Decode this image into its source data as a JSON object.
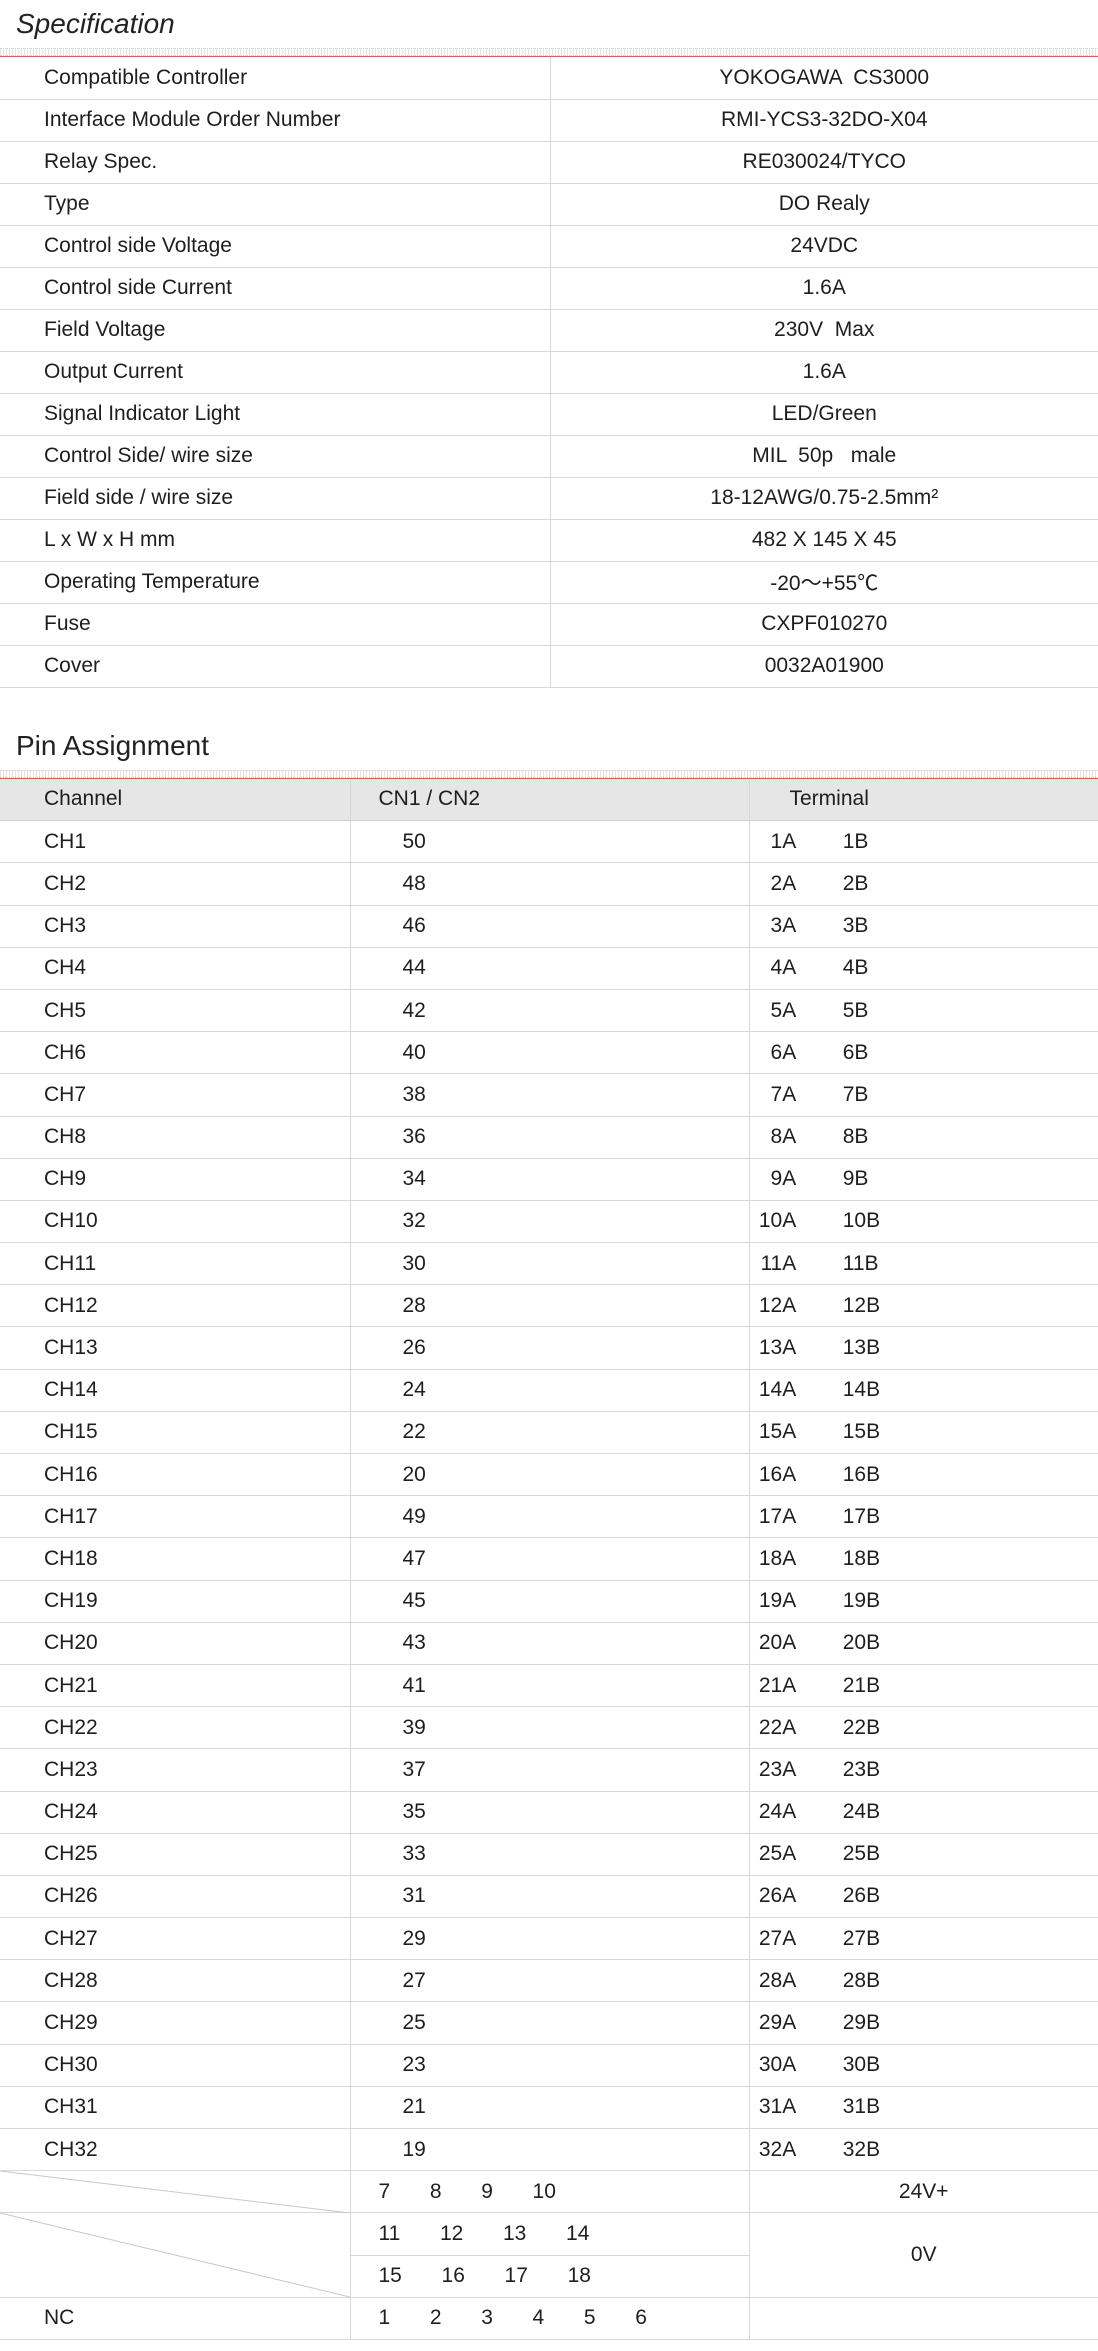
{
  "specification": {
    "title": "Specification",
    "rows": [
      {
        "label": "Compatible Controller",
        "value": "YOKOGAWA  CS3000"
      },
      {
        "label": "Interface Module Order Number",
        "value": "RMI-YCS3-32DO-X04"
      },
      {
        "label": "Relay Spec.",
        "value": "RE030024/TYCO"
      },
      {
        "label": "Type",
        "value": "DO Realy"
      },
      {
        "label": "Control side Voltage",
        "value": "24VDC"
      },
      {
        "label": "Control side Current",
        "value": "1.6A"
      },
      {
        "label": "Field Voltage",
        "value": "230V  Max"
      },
      {
        "label": "Output Current",
        "value": "1.6A"
      },
      {
        "label": "Signal Indicator Light",
        "value": "LED/Green"
      },
      {
        "label": "Control Side/ wire size",
        "value": "MIL  50p   male"
      },
      {
        "label": "Field side / wire size",
        "value": "18-12AWG/0.75-2.5mm²"
      },
      {
        "label": "L x W x H mm",
        "value": "482 X 145 X 45"
      },
      {
        "label": "Operating Temperature",
        "value": "-20～+55℃"
      },
      {
        "label": "Fuse",
        "value": "CXPF010270"
      },
      {
        "label": "Cover",
        "value": "0032A01900"
      }
    ]
  },
  "pin_assignment": {
    "title": "Pin Assignment",
    "headers": {
      "channel": "Channel",
      "cn": "CN1 / CN2",
      "terminal": "Terminal"
    },
    "rows": [
      {
        "ch": "CH1",
        "cn": "50",
        "terminal": "1A  1B"
      },
      {
        "ch": "CH2",
        "cn": "48",
        "terminal": "2A  2B"
      },
      {
        "ch": "CH3",
        "cn": "46",
        "terminal": "3A  3B"
      },
      {
        "ch": "CH4",
        "cn": "44",
        "terminal": "4A  4B"
      },
      {
        "ch": "CH5",
        "cn": "42",
        "terminal": "5A  5B"
      },
      {
        "ch": "CH6",
        "cn": "40",
        "terminal": "6A  6B"
      },
      {
        "ch": "CH7",
        "cn": "38",
        "terminal": "7A  7B"
      },
      {
        "ch": "CH8",
        "cn": "36",
        "terminal": "8A  8B"
      },
      {
        "ch": "CH9",
        "cn": "34",
        "terminal": "9A  9B"
      },
      {
        "ch": "CH10",
        "cn": "32",
        "terminal": "10A  10B"
      },
      {
        "ch": "CH11",
        "cn": "30",
        "terminal": "11A  11B"
      },
      {
        "ch": "CH12",
        "cn": "28",
        "terminal": "12A  12B"
      },
      {
        "ch": "CH13",
        "cn": "26",
        "terminal": "13A  13B"
      },
      {
        "ch": "CH14",
        "cn": "24",
        "terminal": "14A  14B"
      },
      {
        "ch": "CH15",
        "cn": "22",
        "terminal": "15A  15B"
      },
      {
        "ch": "CH16",
        "cn": "20",
        "terminal": "16A  16B"
      },
      {
        "ch": "CH17",
        "cn": "49",
        "terminal": "17A  17B"
      },
      {
        "ch": "CH18",
        "cn": "47",
        "terminal": "18A  18B"
      },
      {
        "ch": "CH19",
        "cn": "45",
        "terminal": "19A  19B"
      },
      {
        "ch": "CH20",
        "cn": "43",
        "terminal": "20A  20B"
      },
      {
        "ch": "CH21",
        "cn": "41",
        "terminal": "21A  21B"
      },
      {
        "ch": "CH22",
        "cn": "39",
        "terminal": "22A  22B"
      },
      {
        "ch": "CH23",
        "cn": "37",
        "terminal": "23A  23B"
      },
      {
        "ch": "CH24",
        "cn": "35",
        "terminal": "24A  24B"
      },
      {
        "ch": "CH25",
        "cn": "33",
        "terminal": "25A  25B"
      },
      {
        "ch": "CH26",
        "cn": "31",
        "terminal": "26A  26B"
      },
      {
        "ch": "CH27",
        "cn": "29",
        "terminal": "27A  27B"
      },
      {
        "ch": "CH28",
        "cn": "27",
        "terminal": "28A  28B"
      },
      {
        "ch": "CH29",
        "cn": "25",
        "terminal": "29A  29B"
      },
      {
        "ch": "CH30",
        "cn": "23",
        "terminal": "30A  30B"
      },
      {
        "ch": "CH31",
        "cn": "21",
        "terminal": "31A  31B"
      },
      {
        "ch": "CH32",
        "cn": "19",
        "terminal": "32A  32B"
      }
    ],
    "power": {
      "pins_24v": "7  8  9  10",
      "label_24v": "24V+",
      "pins_0v_a": "11  12  13  14",
      "pins_0v_b": "15  16  17  18",
      "label_0v": "0V",
      "nc_label": "NC",
      "nc_pins": "1  2  3  4  5  6"
    }
  }
}
